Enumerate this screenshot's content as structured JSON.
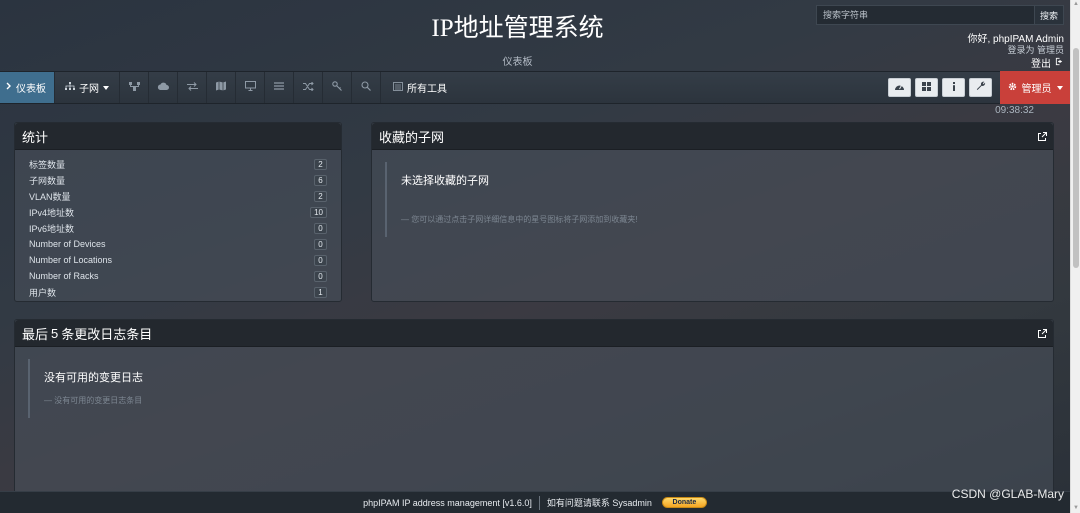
{
  "header": {
    "title": "IP地址管理系统",
    "subtitle": "仪表板",
    "search": {
      "placeholder": "搜索字符串",
      "button_label": "搜索"
    },
    "user": {
      "greeting": "你好, phpIPAM Admin",
      "role": "登录为 管理员",
      "logout_label": "登出"
    }
  },
  "nav": {
    "dashboard_label": "仪表板",
    "subnets_label": "子网",
    "tools_label": "所有工具",
    "admin_label": "管理员",
    "icons": [
      "vlan-icon",
      "cloud-icon",
      "exchange-icon",
      "map-icon",
      "monitor-icon",
      "list-icon",
      "shuffle-icon",
      "key-icon",
      "search-icon"
    ],
    "tool_icons": [
      "dashboard-icon",
      "grid-icon",
      "info-icon",
      "wrench-icon"
    ]
  },
  "time": "09:38:32",
  "stats": {
    "title": "统计",
    "rows": [
      {
        "label": "标签数量",
        "value": "2"
      },
      {
        "label": "子网数量",
        "value": "6"
      },
      {
        "label": "VLAN数量",
        "value": "2"
      },
      {
        "label": "IPv4地址数",
        "value": "10"
      },
      {
        "label": "IPv6地址数",
        "value": "0"
      },
      {
        "label": "Number of Devices",
        "value": "0"
      },
      {
        "label": "Number of Locations",
        "value": "0"
      },
      {
        "label": "Number of Racks",
        "value": "0"
      },
      {
        "label": "用户数",
        "value": "1"
      }
    ]
  },
  "favourites": {
    "title": "收藏的子网",
    "empty_title": "未选择收藏的子网",
    "empty_hint": "— 您可以通过点击子网详细信息中的星号图标将子网添加到收藏夹!"
  },
  "changelog": {
    "title_prefix": "最后",
    "title_count": "5",
    "title_suffix": "条更改日志条目",
    "empty_title": "没有可用的变更日志",
    "empty_hint": "— 没有可用的变更日志条目"
  },
  "footer": {
    "version_text": "phpIPAM IP address management [v1.6.0]",
    "contact_text": "如有问题请联系 Sysadmin",
    "donate_label": "Donate"
  },
  "watermark": "CSDN @GLAB-Mary"
}
